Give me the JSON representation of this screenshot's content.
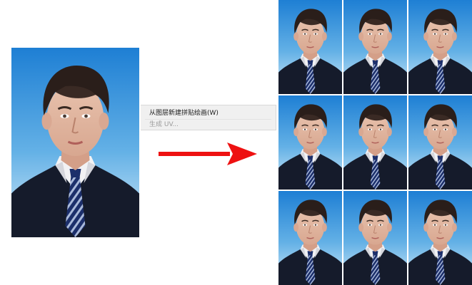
{
  "context_menu": {
    "items": [
      {
        "label": "从图层新建拼贴绘画(W)",
        "enabled": true
      },
      {
        "label": "生成 UV...",
        "enabled": false
      }
    ]
  },
  "arrow": {
    "color": "#ee1111",
    "icon": "right-arrow-icon"
  },
  "portrait": {
    "background_top": "#2a86d6",
    "background_bottom": "#cfe8f8",
    "suit": "#141a2a",
    "tie_stripes": [
      "#1c2f6b",
      "#a9b9da"
    ]
  },
  "tiled_grid": {
    "rows": 3,
    "columns": 3
  }
}
